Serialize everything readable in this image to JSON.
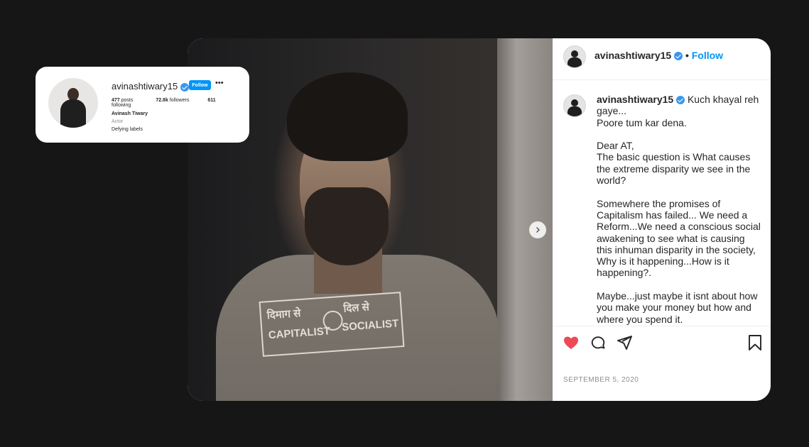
{
  "profile_card": {
    "username": "avinashtiwary15",
    "follow_label": "Follow",
    "more_label": "•••",
    "stats": [
      {
        "value": "477",
        "label": "posts"
      },
      {
        "value": "72.8k",
        "label": "followers"
      },
      {
        "value": "611",
        "label": "following"
      }
    ],
    "full_name": "Avinash Tiwary",
    "category": "Actor",
    "bio": "Defying labels"
  },
  "post": {
    "header": {
      "username": "avinashtiwary15",
      "separator": "•",
      "follow_label": "Follow"
    },
    "photo": {
      "shirt_print": {
        "left_hindi": "दिमाग से",
        "left_english": "CAPITALIST",
        "right_hindi": "दिल से",
        "right_english": "SOCIALIST"
      }
    },
    "caption": {
      "username": "avinashtiwary15",
      "first_line": "Kuch khayal reh gaye...\nPoore tum kar dena.",
      "paragraphs": [
        "Dear AT,\nThe basic question is What causes the extreme disparity we see in the world?",
        "Somewhere the promises of Capitalism has failed... We need a Reform...We need a conscious social awakening to see what is causing this inhuman disparity in the society, Why is it happening...How is it happening?.",
        "Maybe...just maybe it isnt about how you make your money but how and where you spend it."
      ]
    },
    "actions": {
      "like_icon": "heart-filled-icon",
      "comment_icon": "comment-icon",
      "share_icon": "paper-plane-icon",
      "save_icon": "bookmark-icon",
      "liked_color": "#ed4956"
    },
    "date": "SEPTEMBER 5, 2020"
  },
  "colors": {
    "background": "#161616",
    "accent": "#0095f6",
    "verified": "#3897f0"
  }
}
